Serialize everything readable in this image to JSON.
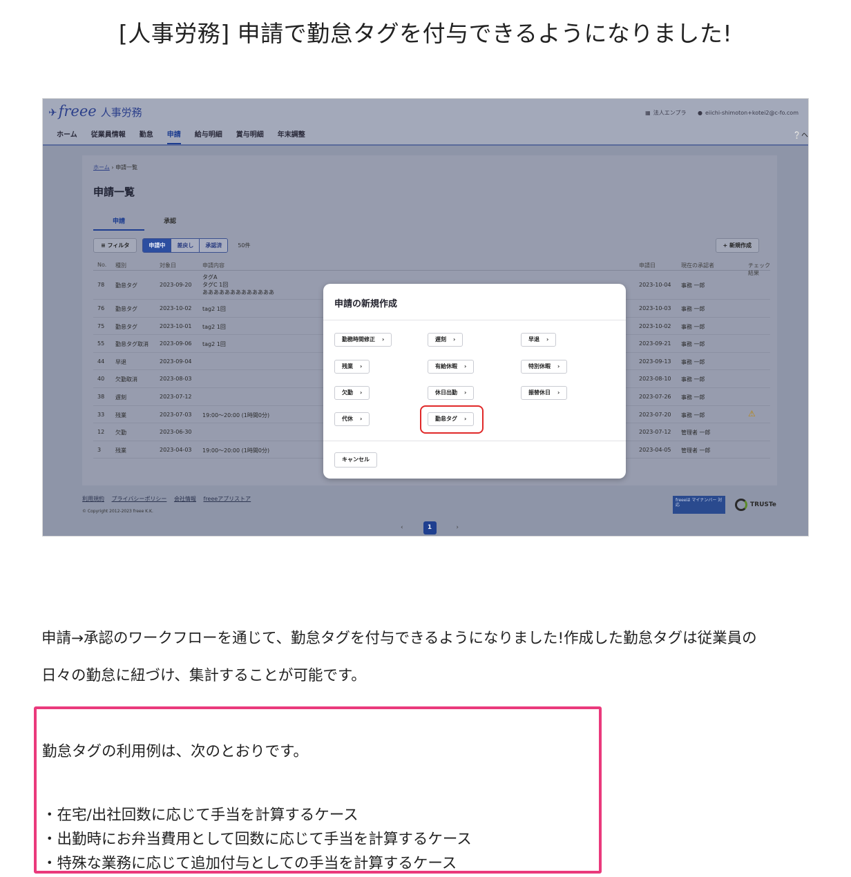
{
  "article": {
    "title": "[人事労務] 申請で勤怠タグを付与できるようになりました!",
    "body_line1": "申請→承認のワークフローを通じて、勤怠タグを付与できるようになりました!作成した勤怠タグは従業員の",
    "body_line2": "日々の勤怠に紐づけ、集計することが可能です。",
    "callout_lead": "勤怠タグの利用例は、次のとおりです。",
    "callout_items": [
      "・在宅/出社回数に応じて手当を計算するケース",
      "・出勤時にお弁当費用として回数に応じて手当を計算するケース",
      "・特殊な業務に応じて追加付与としての手当を計算するケース"
    ]
  },
  "app": {
    "logo_brand": "freee",
    "logo_product": "人事労務",
    "header_company": "法人エンプラ",
    "header_user": "eiichi-shimoton+kotei2@c-fo.com",
    "help": "ヘ",
    "nav": [
      "ホーム",
      "従業員情報",
      "勤怠",
      "申請",
      "給与明細",
      "賞与明細",
      "年末調整"
    ],
    "nav_active": "申請",
    "breadcrumb_home": "ホーム",
    "breadcrumb_current": "申請一覧",
    "page_title": "申請一覧",
    "tabs": [
      "申請",
      "承認"
    ],
    "filter_label": "フィルタ",
    "status_filters": [
      "申請中",
      "差戻し",
      "承認済"
    ],
    "count_label": "50件",
    "new_button": "新規作成",
    "table_headers": {
      "no": "No.",
      "type": "種別",
      "date": "対象日",
      "content": "申請内容",
      "requested": "申請日",
      "approver": "現在の承認者",
      "check": "チェック結果"
    },
    "rows": [
      {
        "no": "78",
        "type": "勤怠タグ",
        "date": "2023-09-20",
        "content": "タグA\nタグC 1回\nあああああああああああああ",
        "requested": "2023-10-04",
        "approver": "事務 一郎",
        "check": ""
      },
      {
        "no": "76",
        "type": "勤怠タグ",
        "date": "2023-10-02",
        "content": "tag2 1回",
        "requested": "2023-10-03",
        "approver": "事務 一郎",
        "check": ""
      },
      {
        "no": "75",
        "type": "勤怠タグ",
        "date": "2023-10-01",
        "content": "tag2 1回",
        "requested": "2023-10-02",
        "approver": "事務 一郎",
        "check": ""
      },
      {
        "no": "55",
        "type": "勤怠タグ取消",
        "date": "2023-09-06",
        "content": "tag2 1回",
        "requested": "2023-09-21",
        "approver": "事務 一郎",
        "check": ""
      },
      {
        "no": "44",
        "type": "早退",
        "date": "2023-09-04",
        "content": "",
        "requested": "2023-09-13",
        "approver": "事務 一郎",
        "check": ""
      },
      {
        "no": "40",
        "type": "欠勤取消",
        "date": "2023-08-03",
        "content": "",
        "requested": "2023-08-10",
        "approver": "事務 一郎",
        "check": ""
      },
      {
        "no": "38",
        "type": "遅刻",
        "date": "2023-07-12",
        "content": "",
        "requested": "2023-07-26",
        "approver": "事務 一郎",
        "check": ""
      },
      {
        "no": "33",
        "type": "残業",
        "date": "2023-07-03",
        "content": "19:00〜20:00 (1時間0分)",
        "requested": "2023-07-20",
        "approver": "事務 一郎",
        "check": "⚠"
      },
      {
        "no": "12",
        "type": "欠勤",
        "date": "2023-06-30",
        "content": "",
        "requested": "2023-07-12",
        "approver": "管理者 一郎",
        "check": ""
      },
      {
        "no": "3",
        "type": "残業",
        "date": "2023-04-03",
        "content": "19:00〜20:00 (1時間0分)",
        "requested": "2023-04-05",
        "approver": "管理者 一郎",
        "check": ""
      }
    ],
    "pager_prev": "‹",
    "pager_current": "1",
    "pager_next": "›",
    "footer_links": [
      "利用規約",
      "プライバシーポリシー",
      "会社情報",
      "freeeアプリストア"
    ],
    "copyright": "© Copyright 2012-2023 freee K.K.",
    "badge_mynumber": "freeeは マイナンバー 対応",
    "badge_truste": "TRUSTe",
    "modal": {
      "title": "申請の新規作成",
      "options": [
        "勤務時間修正",
        "遅刻",
        "早退",
        "残業",
        "有給休暇",
        "特別休暇",
        "欠勤",
        "休日出勤",
        "振替休日",
        "代休",
        "勤怠タグ"
      ],
      "highlighted": "勤怠タグ",
      "cancel": "キャンセル"
    }
  },
  "colors": {
    "callout_border": "#ea3a7c",
    "highlight_border": "#e02828",
    "brand_blue": "#1f3f8f"
  }
}
